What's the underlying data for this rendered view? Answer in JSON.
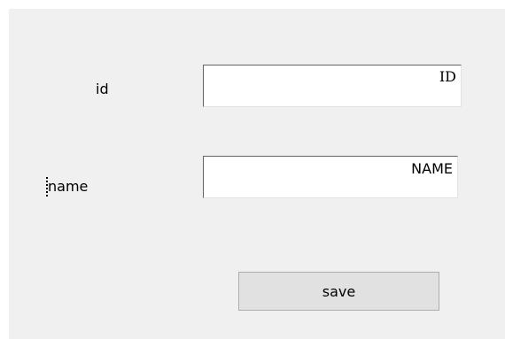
{
  "form": {
    "id_label": "id",
    "id_value": "ID",
    "name_label": "name",
    "name_value": "NAME",
    "save_label": "save"
  }
}
